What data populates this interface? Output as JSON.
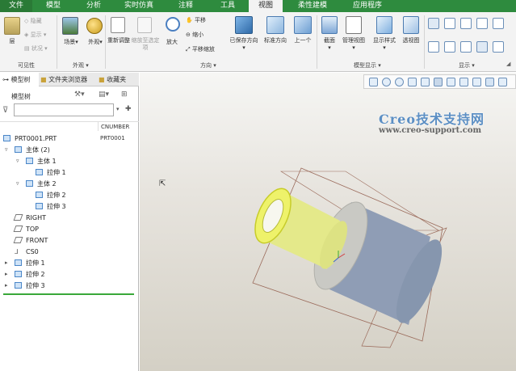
{
  "menu": {
    "tabs": [
      {
        "label": "文件"
      },
      {
        "label": "模型"
      },
      {
        "label": "分析"
      },
      {
        "label": "实时仿真"
      },
      {
        "label": "注释"
      },
      {
        "label": "工具"
      },
      {
        "label": "视图"
      },
      {
        "label": "柔性建模"
      },
      {
        "label": "应用程序"
      }
    ],
    "active": "视图"
  },
  "ribbon": {
    "visibility": {
      "layer": "层",
      "hide": "隐藏",
      "show": "显示",
      "status": "状况",
      "group": "可见性"
    },
    "appearance": {
      "scene": "场景",
      "looks": "外观",
      "group": "外观"
    },
    "orientation": {
      "refit": "重新调整",
      "zoom_to_selected": "缩放至选定项",
      "zoom_in": "放大",
      "pan": "平移",
      "zoom_out": "缩小",
      "pan_zoom": "平移缩放",
      "group": "方向"
    },
    "saved": {
      "saved_orientation": "已保存方向",
      "standard_orientation": "标准方向",
      "previous": "上一个"
    },
    "model_display": {
      "section": "截面",
      "manage_views": "管理视图",
      "display_style": "显示样式",
      "perspective": "透视图",
      "group": "模型显示"
    },
    "show": {
      "group": "显示"
    }
  },
  "panel": {
    "tabs": {
      "model_tree": "模型树",
      "folder_browser": "文件夹浏览器",
      "favorites": "收藏夹"
    },
    "tree_label": "模型树",
    "column_header": "CNUMBER",
    "column_value": "PRT0001",
    "items": [
      {
        "label": "PRT0001.PRT"
      },
      {
        "label": "主体 (2)"
      },
      {
        "label": "主体 1"
      },
      {
        "label": "拉伸 1"
      },
      {
        "label": "主体 2"
      },
      {
        "label": "拉伸 2"
      },
      {
        "label": "拉伸 3"
      },
      {
        "label": "RIGHT"
      },
      {
        "label": "TOP"
      },
      {
        "label": "FRONT"
      },
      {
        "label": "CS0"
      },
      {
        "label": "拉伸 1"
      },
      {
        "label": "拉伸 2"
      },
      {
        "label": "拉伸 3"
      }
    ]
  },
  "watermark": {
    "title": "Creo技术支持网",
    "url": "www.creo-support.com"
  },
  "colors": {
    "menu_green": "#2e8b3e",
    "highlight_yellow": "#e9ef5a",
    "body_blue_gray": "#8e9cb4"
  }
}
